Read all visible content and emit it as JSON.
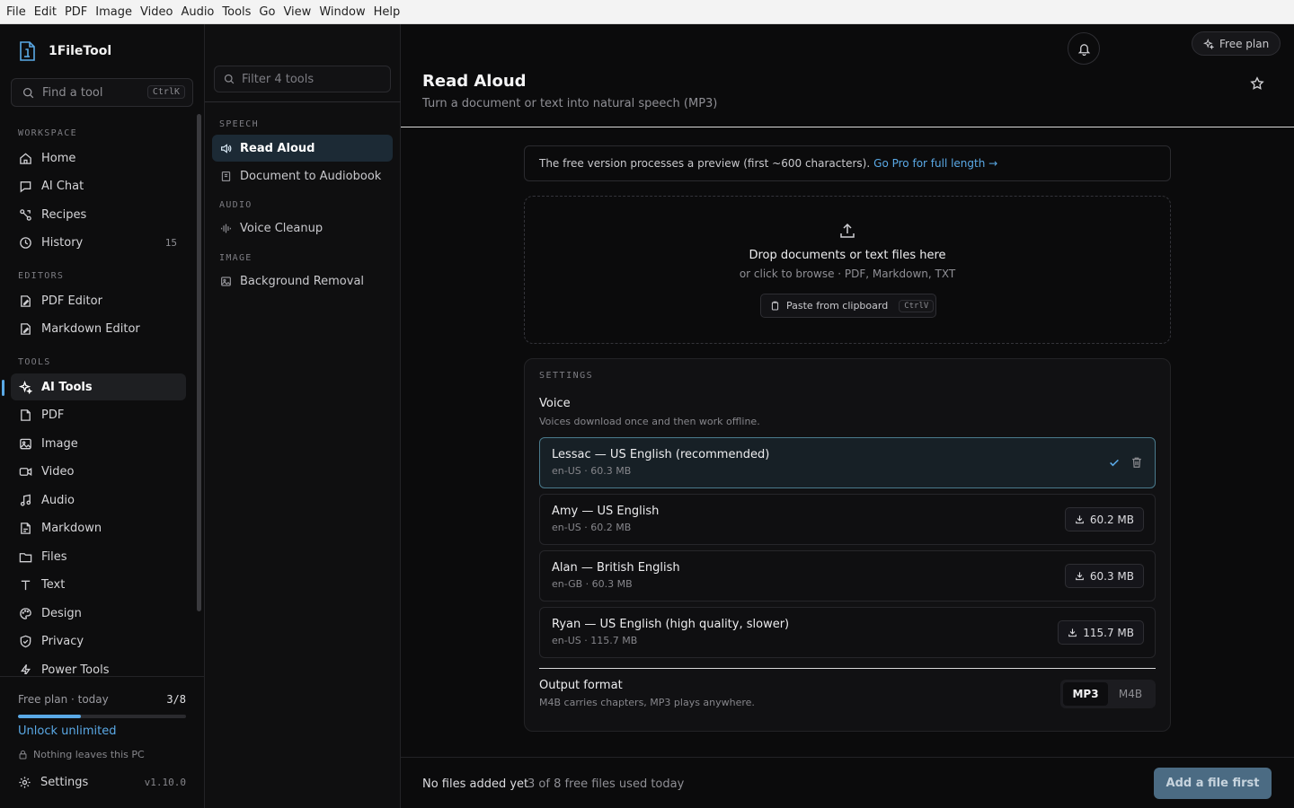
{
  "menu": [
    "File",
    "Edit",
    "PDF",
    "Image",
    "Video",
    "Audio",
    "Tools",
    "Go",
    "View",
    "Window",
    "Help"
  ],
  "app": {
    "name": "1FileTool",
    "search_placeholder": "Find a tool",
    "search_shortcut": "CtrlK"
  },
  "sidebar": {
    "sections": [
      {
        "label": "WORKSPACE",
        "items": [
          {
            "label": "Home",
            "icon": "home-icon"
          },
          {
            "label": "AI Chat",
            "icon": "chat-icon"
          },
          {
            "label": "Recipes",
            "icon": "recipes-icon"
          },
          {
            "label": "History",
            "icon": "history-icon",
            "count": "15"
          }
        ]
      },
      {
        "label": "EDITORS",
        "items": [
          {
            "label": "PDF Editor",
            "icon": "pdf-editor-icon"
          },
          {
            "label": "Markdown Editor",
            "icon": "markdown-editor-icon"
          }
        ]
      },
      {
        "label": "TOOLS",
        "items": [
          {
            "label": "AI Tools",
            "icon": "sparkle-icon",
            "active": true
          },
          {
            "label": "PDF",
            "icon": "pdf-icon"
          },
          {
            "label": "Image",
            "icon": "image-icon"
          },
          {
            "label": "Video",
            "icon": "video-icon"
          },
          {
            "label": "Audio",
            "icon": "audio-icon"
          },
          {
            "label": "Markdown",
            "icon": "markdown-icon"
          },
          {
            "label": "Files",
            "icon": "folder-icon"
          },
          {
            "label": "Text",
            "icon": "text-icon"
          },
          {
            "label": "Design",
            "icon": "palette-icon"
          },
          {
            "label": "Privacy",
            "icon": "shield-icon"
          },
          {
            "label": "Power Tools",
            "icon": "bolt-icon"
          }
        ]
      }
    ],
    "plan": {
      "label": "Free plan · today",
      "count": "3/8",
      "progress": 0.375,
      "unlock": "Unlock unlimited",
      "privacy": "Nothing leaves this PC"
    },
    "settings": {
      "label": "Settings",
      "version": "v1.10.0"
    }
  },
  "tools_panel": {
    "filter_placeholder": "Filter 4 tools",
    "sections": [
      {
        "label": "SPEECH",
        "items": [
          {
            "label": "Read Aloud",
            "icon": "speaker-icon",
            "active": true
          },
          {
            "label": "Document to Audiobook",
            "icon": "book-icon"
          }
        ]
      },
      {
        "label": "AUDIO",
        "items": [
          {
            "label": "Voice Cleanup",
            "icon": "waveform-icon"
          }
        ]
      },
      {
        "label": "IMAGE",
        "items": [
          {
            "label": "Background Removal",
            "icon": "image-remove-icon"
          }
        ]
      }
    ]
  },
  "header": {
    "free_plan": "Free plan",
    "title": "Read Aloud",
    "subtitle": "Turn a document or text into natural speech (MP3)"
  },
  "notice": {
    "text": "The free version processes a preview (first ~600 characters).",
    "link": "Go Pro for full length →"
  },
  "dropzone": {
    "title": "Drop documents or text files here",
    "subtitle": "or click to browse · PDF, Markdown, TXT",
    "paste_label": "Paste from clipboard",
    "paste_shortcut": "CtrlV"
  },
  "settings": {
    "label": "SETTINGS",
    "voice_title": "Voice",
    "voice_desc": "Voices download once and then work offline.",
    "voices": [
      {
        "name": "Lessac — US English (recommended)",
        "meta": "en-US · 60.3 MB",
        "selected": true
      },
      {
        "name": "Amy — US English",
        "meta": "en-US · 60.2 MB",
        "download": "60.2 MB"
      },
      {
        "name": "Alan — British English",
        "meta": "en-GB · 60.3 MB",
        "download": "60.3 MB"
      },
      {
        "name": "Ryan — US English (high quality, slower)",
        "meta": "en-US · 115.7 MB",
        "download": "115.7 MB"
      }
    ],
    "output_title": "Output format",
    "output_desc": "M4B carries chapters, MP3 plays anywhere.",
    "formats": [
      "MP3",
      "M4B"
    ],
    "selected_format": "MP3"
  },
  "footer": {
    "status": "No files added yet",
    "usage": "3 of 8 free files used today",
    "cta": "Add a file first"
  },
  "colors": {
    "accent": "#5aa9e6",
    "cta": "#4b6b83",
    "selected_voice_border": "#4a7a8c"
  }
}
